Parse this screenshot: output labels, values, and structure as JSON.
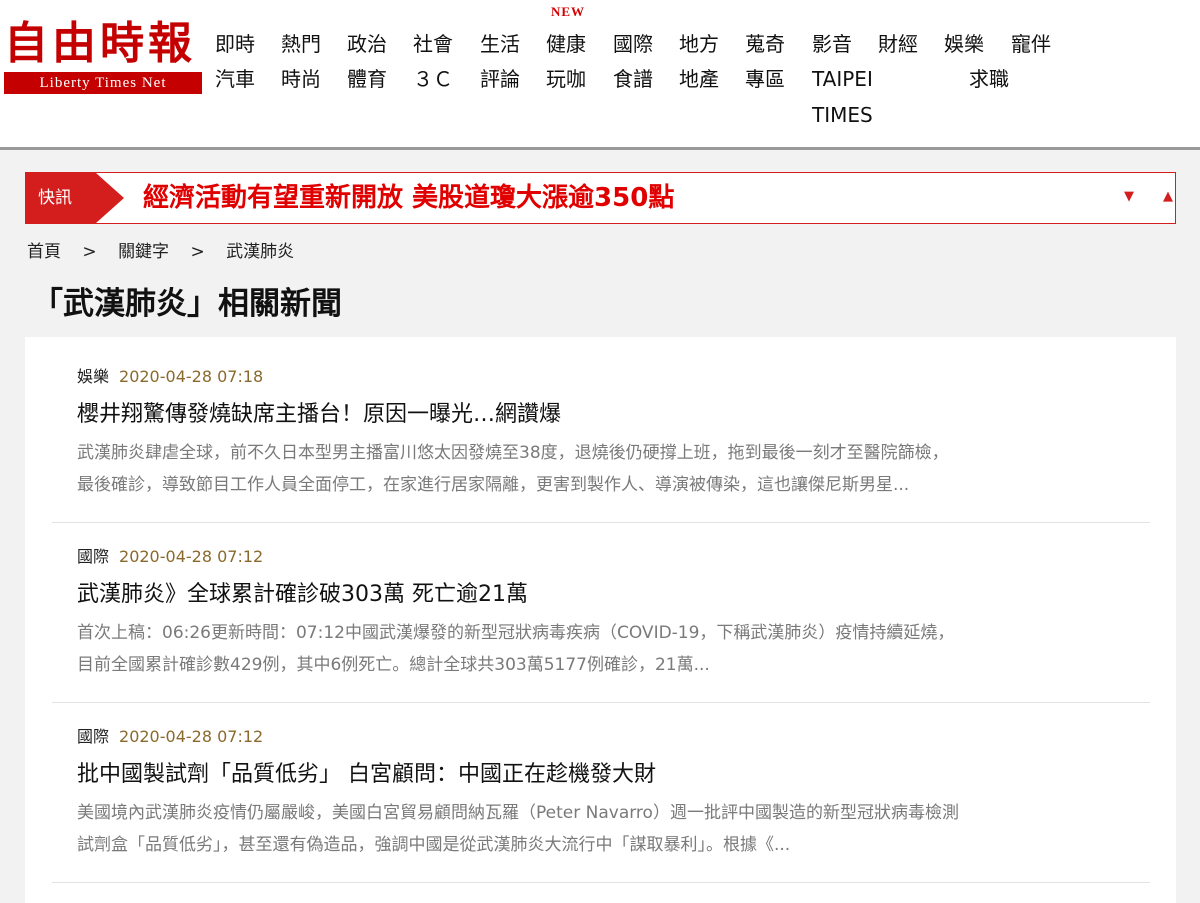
{
  "logo": {
    "name_cn": "自由時報",
    "name_en": "Liberty  Times  Net"
  },
  "nav": {
    "new_badge": "NEW",
    "row1": [
      "即時",
      "熱門",
      "政治",
      "社會",
      "生活",
      "健康",
      "國際",
      "地方",
      "蒐奇",
      "影音",
      "財經",
      "娛樂",
      "寵伴"
    ],
    "row2": [
      "汽車",
      "時尚",
      "體育",
      "３Ｃ",
      "評論",
      "玩咖",
      "食譜",
      "地產",
      "專區",
      "TAIPEI",
      "求職"
    ],
    "row3": [
      "TIMES"
    ]
  },
  "ticker": {
    "label": "快訊",
    "text": "經濟活動有望重新開放 美股道瓊大漲逾350點",
    "down_glyph": "▼",
    "up_glyph": "▲"
  },
  "breadcrumb": {
    "home": "首頁",
    "sep": ">",
    "keyword": "關鍵字",
    "current": "武漢肺炎"
  },
  "page_title": "「武漢肺炎」相關新聞",
  "articles": [
    {
      "category": "娛樂",
      "time": "2020-04-28 07:18",
      "title": "櫻井翔驚傳發燒缺席主播台！原因一曝光…網讚爆",
      "summary_lines": [
        "武漢肺炎肆虐全球，前不久日本型男主播富川悠太因發燒至38度，退燒後仍硬撐上班，拖到最後一刻才至醫院篩檢，",
        "最後確診，導致節目工作人員全面停工，在家進行居家隔離，更害到製作人、導演被傳染，這也讓傑尼斯男星..."
      ]
    },
    {
      "category": "國際",
      "time": "2020-04-28 07:12",
      "title": "武漢肺炎》全球累計確診破303萬 死亡逾21萬",
      "summary_lines": [
        "首次上稿：06:26更新時間：07:12中國武漢爆發的新型冠狀病毒疾病（COVID-19，下稱武漢肺炎）疫情持續延燒，",
        "目前全國累計確診數429例，其中6例死亡。總計全球共303萬5177例確診，21萬..."
      ]
    },
    {
      "category": "國際",
      "time": "2020-04-28 07:12",
      "title": "批中國製試劑「品質低劣」 白宮顧問：中國正在趁機發大財",
      "summary_lines": [
        "美國境內武漢肺炎疫情仍屬嚴峻，美國白宮貿易顧問納瓦羅（Peter Navarro）週一批評中國製造的新型冠狀病毒檢測",
        "試劑盒「品質低劣」，甚至還有偽造品，強調中國是從武漢肺炎大流行中「謀取暴利」。根據《..."
      ]
    }
  ],
  "colors": {
    "brand_red": "#c40000",
    "ticker_red": "#d41e1e",
    "time_brown": "#8a6a2c",
    "summary_gray": "#7a7a7a"
  }
}
